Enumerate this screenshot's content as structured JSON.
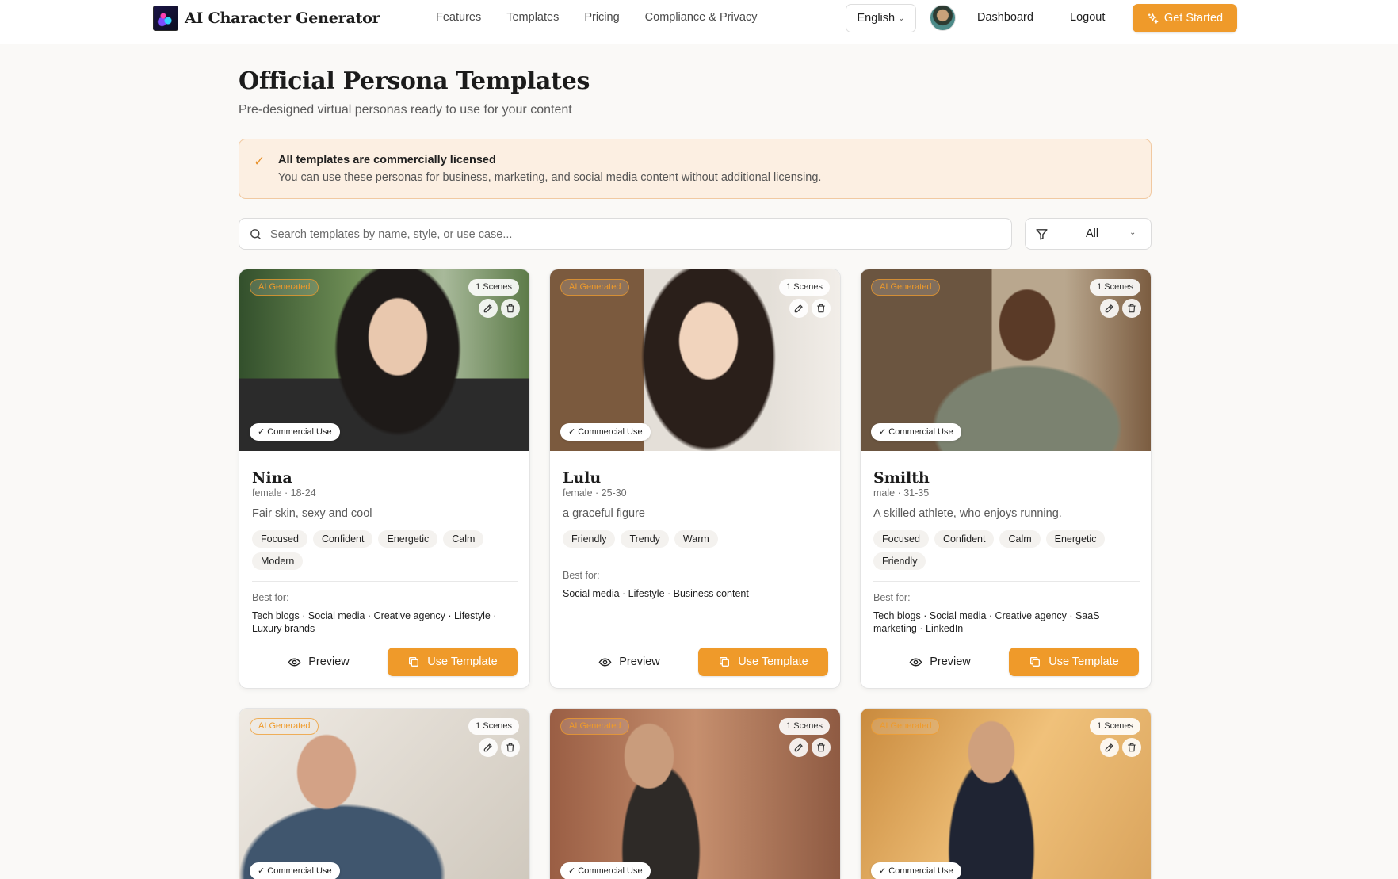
{
  "header": {
    "brand": "AI Character Generator",
    "nav": [
      "Features",
      "Templates",
      "Pricing",
      "Compliance & Privacy"
    ],
    "language": "English",
    "dashboard": "Dashboard",
    "logout": "Logout",
    "cta": "Get Started"
  },
  "page": {
    "title": "Official Persona Templates",
    "subtitle": "Pre-designed virtual personas ready to use for your content"
  },
  "notice": {
    "title": "All templates are commercially licensed",
    "body": "You can use these personas for business, marketing, and social media content without additional licensing."
  },
  "search": {
    "placeholder": "Search templates by name, style, or use case..."
  },
  "filter": {
    "value": "All"
  },
  "card_labels": {
    "ai_badge": "AI Generated",
    "commercial": "Commercial Use",
    "best_for": "Best for:",
    "preview": "Preview",
    "use": "Use Template"
  },
  "cards": [
    {
      "scenes": "1 Scenes",
      "name": "Nina",
      "meta": "female · 18-24",
      "desc": "Fair skin, sexy and cool",
      "tags": [
        "Focused",
        "Confident",
        "Energetic",
        "Calm",
        "Modern"
      ],
      "best": "Tech blogs · Social media · Creative agency · Lifestyle · Luxury brands"
    },
    {
      "scenes": "1 Scenes",
      "name": "Lulu",
      "meta": "female · 25-30",
      "desc": "a graceful figure",
      "tags": [
        "Friendly",
        "Trendy",
        "Warm"
      ],
      "best": "Social media · Lifestyle · Business content"
    },
    {
      "scenes": "1 Scenes",
      "name": "Smilth",
      "meta": "male · 31-35",
      "desc": "A skilled athlete, who enjoys running.",
      "tags": [
        "Focused",
        "Confident",
        "Calm",
        "Energetic",
        "Friendly"
      ],
      "best": "Tech blogs · Social media · Creative agency · SaaS marketing · LinkedIn"
    },
    {
      "scenes": "1 Scenes"
    },
    {
      "scenes": "1 Scenes"
    },
    {
      "scenes": "1 Scenes"
    }
  ],
  "colors": {
    "accent": "#ef9a2a",
    "notice_bg": "#fcefe2",
    "page_bg": "#faf9f7"
  }
}
